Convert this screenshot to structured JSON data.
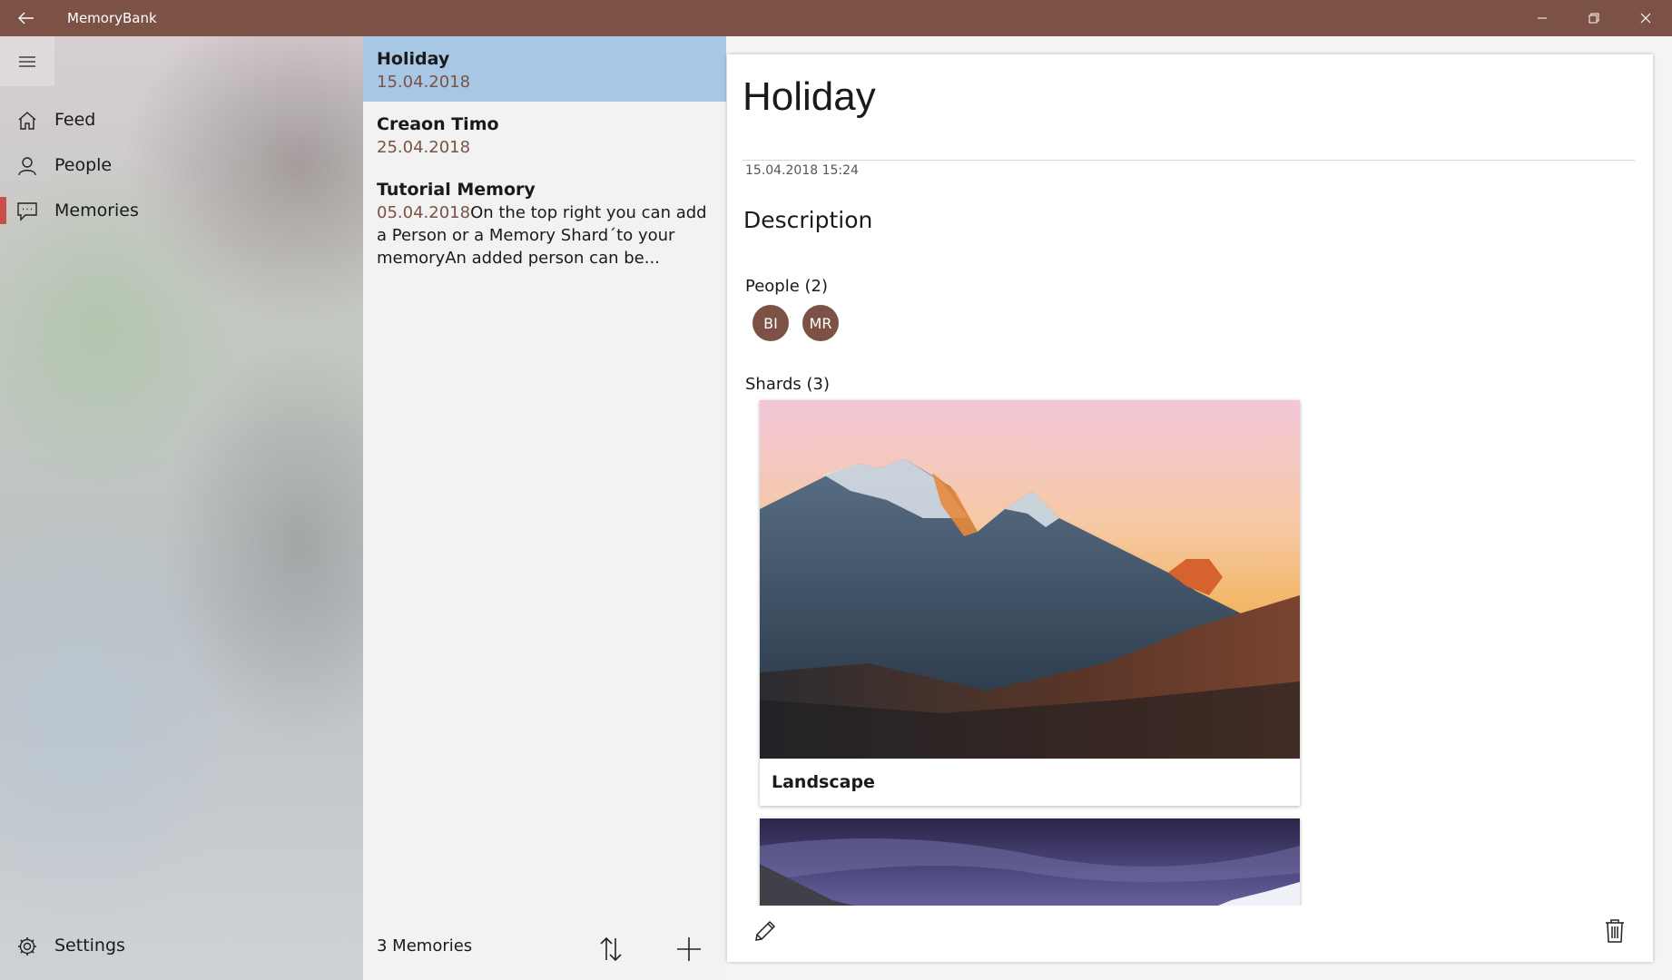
{
  "app": {
    "title": "MemoryBank"
  },
  "colors": {
    "accent": "#7b5245",
    "selection": "#a7c7e5",
    "active_indicator": "#c9504a"
  },
  "nav": {
    "items": [
      {
        "label": "Feed",
        "icon": "home-icon"
      },
      {
        "label": "People",
        "icon": "person-icon"
      },
      {
        "label": "Memories",
        "icon": "chat-icon",
        "selected": true
      }
    ],
    "settings_label": "Settings"
  },
  "list": {
    "items": [
      {
        "title": "Holiday",
        "date": "15.04.2018",
        "selected": true
      },
      {
        "title": "Creaon Timo",
        "date": "25.04.2018"
      },
      {
        "title": "Tutorial Memory",
        "date": "05.04.2018",
        "preview": "On the top right you can add a Person or a Memory Shard´to your memoryAn added person can be..."
      }
    ],
    "count_label": "3 Memories"
  },
  "detail": {
    "title": "Holiday",
    "timestamp": "15.04.2018 15:24",
    "description_heading": "Description",
    "people_heading": "People (2)",
    "people": [
      "BI",
      "MR"
    ],
    "shards_heading": "Shards (3)",
    "shards": [
      {
        "caption": "Landscape",
        "image": "mountain-sunset-photo"
      },
      {
        "caption": "",
        "image": "mountain-clouds-photo"
      }
    ]
  }
}
